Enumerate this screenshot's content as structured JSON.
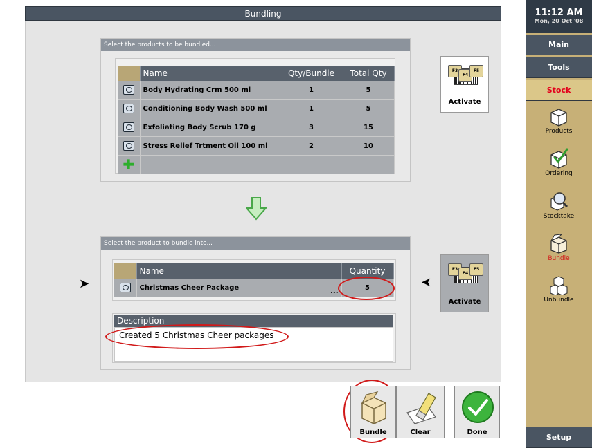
{
  "window": {
    "title": "Bundling"
  },
  "top_section": {
    "header": "Select the products to be bundled...",
    "columns": [
      "Name",
      "Qty/Bundle",
      "Total Qty"
    ],
    "rows": [
      {
        "name": "Body Hydrating Crm 500 ml",
        "qty_bundle": "1",
        "total_qty": "5"
      },
      {
        "name": "Conditioning Body Wash 500 ml",
        "qty_bundle": "1",
        "total_qty": "5"
      },
      {
        "name": "Exfoliating Body Scrub 170 g",
        "qty_bundle": "3",
        "total_qty": "15"
      },
      {
        "name": "Stress Relief Trtment Oil 100 ml",
        "qty_bundle": "2",
        "total_qty": "10"
      }
    ],
    "activate_label": "Activate",
    "key_labels": [
      "F3",
      "F4",
      "F5"
    ]
  },
  "bottom_section": {
    "header": "Select the product to bundle into...",
    "columns": [
      "Name",
      "Quantity"
    ],
    "row": {
      "name": "Christmas Cheer Package",
      "ellipsis": "...",
      "quantity": "5"
    },
    "description_label": "Description",
    "description_value": "Created 5 Christmas Cheer packages",
    "activate_label": "Activate",
    "key_labels": [
      "F3",
      "F4",
      "F5"
    ]
  },
  "pointers": {
    "left": "➤",
    "right": "➤"
  },
  "actions": {
    "bundle_label": "Bundle",
    "clear_label": "Clear",
    "done_label": "Done"
  },
  "sidebar": {
    "time": "11:12 AM",
    "date": "Mon, 20 Oct '08",
    "main_label": "Main",
    "tools_label": "Tools",
    "stock_label": "Stock",
    "items": [
      {
        "label": "Products",
        "icon": "box-icon"
      },
      {
        "label": "Ordering",
        "icon": "check-box-icon"
      },
      {
        "label": "Stocktake",
        "icon": "magnifier-box-icon"
      },
      {
        "label": "Bundle",
        "icon": "bundle-icon",
        "active": true
      },
      {
        "label": "Unbundle",
        "icon": "unbundle-icon"
      }
    ],
    "setup_label": "Setup"
  },
  "colors": {
    "accent_red": "#d11a1a",
    "header_slate": "#4a5562",
    "sidebar_gold": "#c7b077"
  }
}
